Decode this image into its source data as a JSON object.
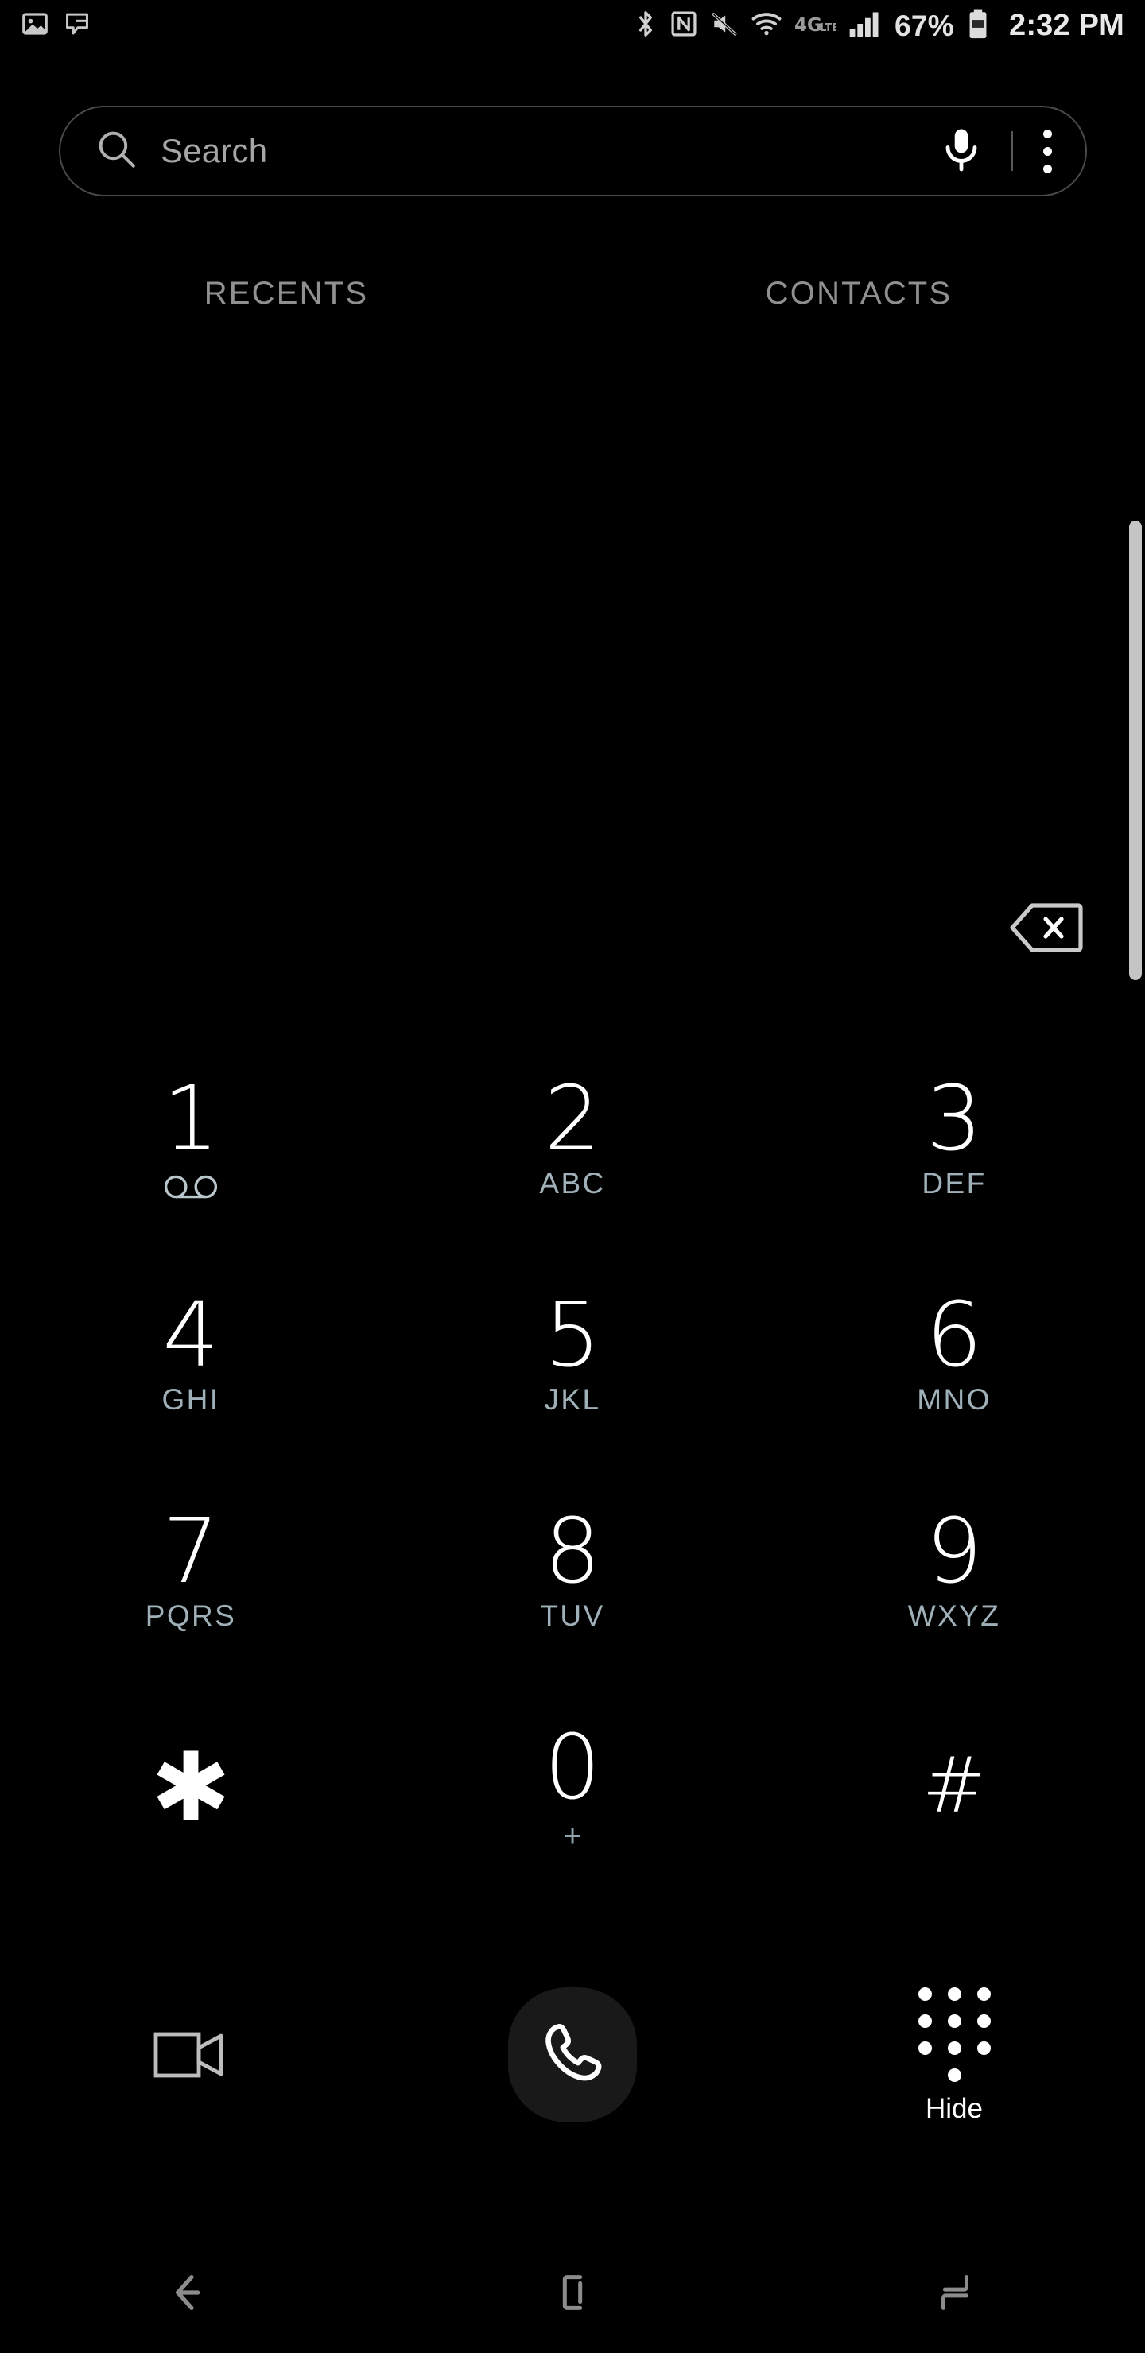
{
  "status_bar": {
    "left_icons": [
      {
        "name": "image-icon",
        "label": "image"
      },
      {
        "name": "message-icon",
        "label": "message"
      }
    ],
    "right_icons": [
      {
        "name": "bluetooth-icon",
        "label": "bluetooth"
      },
      {
        "name": "nfc-icon",
        "label": "nfc"
      },
      {
        "name": "mute-icon",
        "label": "sound off"
      },
      {
        "name": "wifi-icon",
        "label": "wifi"
      },
      {
        "name": "lte-icon",
        "label": "4G LTE"
      },
      {
        "name": "signal-icon",
        "label": "signal"
      }
    ],
    "network_label": "4G",
    "network_sub": "LTE",
    "battery_percent": "67%",
    "clock": "2:32 PM"
  },
  "search": {
    "placeholder": "Search",
    "mic_icon": "microphone-icon",
    "overflow_icon": "more-options-icon"
  },
  "tabs": [
    {
      "label": "RECENTS",
      "name": "tab-recents",
      "selected": false
    },
    {
      "label": "CONTACTS",
      "name": "tab-contacts",
      "selected": false
    }
  ],
  "display": {
    "number": "",
    "backspace_icon": "backspace-icon"
  },
  "keypad": {
    "rows": [
      [
        {
          "digit": "1",
          "sub": "",
          "icon": "voicemail-icon"
        },
        {
          "digit": "2",
          "sub": "ABC",
          "icon": ""
        },
        {
          "digit": "3",
          "sub": "DEF",
          "icon": ""
        }
      ],
      [
        {
          "digit": "4",
          "sub": "GHI",
          "icon": ""
        },
        {
          "digit": "5",
          "sub": "JKL",
          "icon": ""
        },
        {
          "digit": "6",
          "sub": "MNO",
          "icon": ""
        }
      ],
      [
        {
          "digit": "7",
          "sub": "PQRS",
          "icon": ""
        },
        {
          "digit": "8",
          "sub": "TUV",
          "icon": ""
        },
        {
          "digit": "9",
          "sub": "WXYZ",
          "icon": ""
        }
      ],
      [
        {
          "digit": "✱",
          "sub": "",
          "icon": ""
        },
        {
          "digit": "0",
          "sub": "+",
          "icon": ""
        },
        {
          "digit": "#",
          "sub": "",
          "icon": ""
        }
      ]
    ]
  },
  "actions": {
    "video_call_icon": "video-call-icon",
    "call_icon": "call-icon",
    "keypad_icon": "keypad-dots-icon",
    "hide_label": "Hide"
  },
  "navbar": {
    "back_icon": "back-icon",
    "home_icon": "home-icon",
    "recents_icon": "recents-icon"
  },
  "colors": {
    "background": "#000000",
    "digit": "#ffffff",
    "sub_label": "#9fb0b8",
    "tab_label": "#909090",
    "placeholder": "#a6a6a6",
    "call_button_bg": "#191919",
    "scrollbar": "#c5c5c5"
  }
}
